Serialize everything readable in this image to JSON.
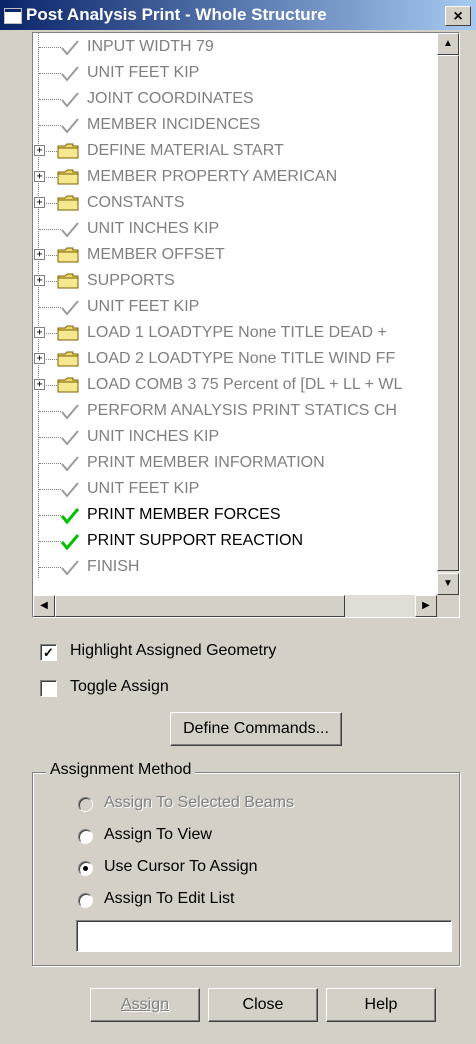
{
  "window": {
    "title": "Post Analysis Print - Whole Structure",
    "close_label": "×"
  },
  "tree": {
    "items": [
      {
        "label": "INPUT WIDTH 79",
        "kind": "check",
        "active": false
      },
      {
        "label": "UNIT FEET KIP",
        "kind": "check",
        "active": false
      },
      {
        "label": "JOINT COORDINATES",
        "kind": "check",
        "active": false
      },
      {
        "label": "MEMBER INCIDENCES",
        "kind": "check",
        "active": false
      },
      {
        "label": "DEFINE MATERIAL START",
        "kind": "folder",
        "active": false
      },
      {
        "label": "MEMBER PROPERTY AMERICAN",
        "kind": "folder",
        "active": false
      },
      {
        "label": "CONSTANTS",
        "kind": "folder",
        "active": false
      },
      {
        "label": "UNIT INCHES KIP",
        "kind": "check",
        "active": false
      },
      {
        "label": "MEMBER OFFSET",
        "kind": "folder",
        "active": false
      },
      {
        "label": "SUPPORTS",
        "kind": "folder",
        "active": false
      },
      {
        "label": "UNIT FEET KIP",
        "kind": "check",
        "active": false
      },
      {
        "label": "LOAD 1 LOADTYPE None  TITLE DEAD +",
        "kind": "folder",
        "active": false
      },
      {
        "label": "LOAD 2 LOADTYPE None  TITLE WIND FF",
        "kind": "folder",
        "active": false
      },
      {
        "label": "LOAD COMB 3 75 Percent of [DL + LL + WL",
        "kind": "folder",
        "active": false
      },
      {
        "label": "PERFORM ANALYSIS PRINT STATICS CH",
        "kind": "check",
        "active": false
      },
      {
        "label": "UNIT INCHES KIP",
        "kind": "check",
        "active": false
      },
      {
        "label": "PRINT MEMBER INFORMATION",
        "kind": "check",
        "active": false
      },
      {
        "label": "UNIT FEET KIP",
        "kind": "check",
        "active": false
      },
      {
        "label": "PRINT MEMBER FORCES",
        "kind": "check",
        "active": true
      },
      {
        "label": "PRINT SUPPORT REACTION",
        "kind": "check",
        "active": true
      },
      {
        "label": "FINISH",
        "kind": "check",
        "active": false
      }
    ],
    "expander": "+",
    "scroll_up": "▲",
    "scroll_down": "▼",
    "scroll_left": "◀",
    "scroll_right": "▶"
  },
  "options": {
    "highlight_label": "Highlight Assigned Geometry",
    "highlight_checked": true,
    "highlight_mark": "✓",
    "toggle_label": "Toggle Assign",
    "toggle_checked": false
  },
  "define_commands_label": "Define Commands...",
  "assignment": {
    "title": "Assignment Method",
    "options": [
      {
        "label": "Assign To Selected Beams",
        "selected": false,
        "disabled": true
      },
      {
        "label": "Assign To View",
        "selected": false,
        "disabled": false
      },
      {
        "label": "Use Cursor To Assign",
        "selected": true,
        "disabled": false
      },
      {
        "label": "Assign To Edit List",
        "selected": false,
        "disabled": false
      }
    ],
    "edit_list_value": ""
  },
  "buttons": {
    "assign_label": "Assign",
    "close_label": "Close",
    "help_label": "Help"
  },
  "colors": {
    "active_check": "#00c000",
    "inactive_check": "#9a9a9a",
    "folder": "#e8d870"
  }
}
